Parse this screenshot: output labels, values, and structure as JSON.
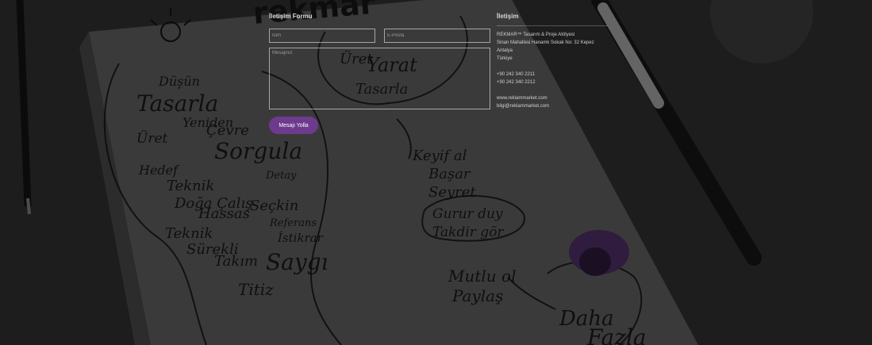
{
  "form": {
    "title": "İletişim Formu",
    "name_placeholder": "İsim",
    "email_placeholder": "E-Posta",
    "message_placeholder": "Mesajınız",
    "send_label": "Mesajı Yolla",
    "button_color": "#6e3a8e"
  },
  "contact": {
    "title": "İletişim",
    "company": "REKMAR™ Tasarım & Proje Atölyesi",
    "address": "Sinan Mahallesi Hanamk Sokak No: 32 Kepez Antalya",
    "country": "Türkiye",
    "phone1": "+90 242 340 2211",
    "phone2": "+90 242 340 2212",
    "web": "www.reklammarket.com",
    "email": "bilgi@reklammarket.com"
  },
  "background": {
    "brand": "rekmar",
    "sketch_words": [
      "Düşün",
      "Tasarla",
      "Üret",
      "Yeniden",
      "Çevre",
      "Sorgula",
      "Hedef",
      "Teknik",
      "Detay",
      "Doğa",
      "Çalış",
      "Hassas",
      "Seçkin",
      "Referans",
      "Teknik",
      "Sürekli",
      "İstikrar",
      "Takım",
      "Saygı",
      "Titiz",
      "Üret",
      "Yarat",
      "Tasarla",
      "Keyif al",
      "Başar",
      "Seyret",
      "Gurur duy",
      "Takdir gör",
      "Mutlu ol",
      "Paylaş",
      "Daha",
      "Fazla"
    ]
  }
}
